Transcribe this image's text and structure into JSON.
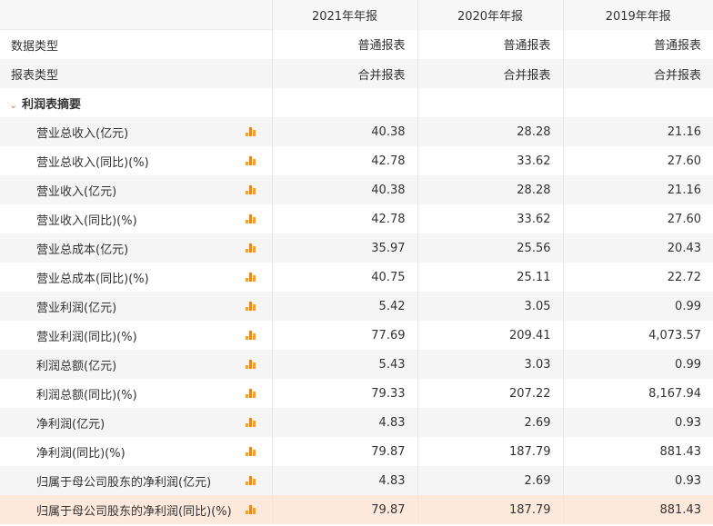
{
  "header": {
    "years": [
      "2021年年报",
      "2020年年报",
      "2019年年报"
    ]
  },
  "meta_rows": [
    {
      "label": "数据类型",
      "values": [
        "普通报表",
        "普通报表",
        "普通报表"
      ]
    },
    {
      "label": "报表类型",
      "values": [
        "合并报表",
        "合并报表",
        "合并报表"
      ]
    }
  ],
  "section": {
    "toggle_icon": "chevron-down-icon",
    "title": "利润表摘要"
  },
  "rows": [
    {
      "label": "营业总收入(亿元)",
      "values": [
        "40.38",
        "28.28",
        "21.16"
      ]
    },
    {
      "label": "营业总收入(同比)(%)",
      "values": [
        "42.78",
        "33.62",
        "27.60"
      ]
    },
    {
      "label": "营业收入(亿元)",
      "values": [
        "40.38",
        "28.28",
        "21.16"
      ]
    },
    {
      "label": "营业收入(同比)(%)",
      "values": [
        "42.78",
        "33.62",
        "27.60"
      ]
    },
    {
      "label": "营业总成本(亿元)",
      "values": [
        "35.97",
        "25.56",
        "20.43"
      ]
    },
    {
      "label": "营业总成本(同比)(%)",
      "values": [
        "40.75",
        "25.11",
        "22.72"
      ]
    },
    {
      "label": "营业利润(亿元)",
      "values": [
        "5.42",
        "3.05",
        "0.99"
      ]
    },
    {
      "label": "营业利润(同比)(%)",
      "values": [
        "77.69",
        "209.41",
        "4,073.57"
      ]
    },
    {
      "label": "利润总额(亿元)",
      "values": [
        "5.43",
        "3.03",
        "0.99"
      ]
    },
    {
      "label": "利润总额(同比)(%)",
      "values": [
        "79.33",
        "207.22",
        "8,167.94"
      ]
    },
    {
      "label": "净利润(亿元)",
      "values": [
        "4.83",
        "2.69",
        "0.93"
      ]
    },
    {
      "label": "净利润(同比)(%)",
      "values": [
        "79.87",
        "187.79",
        "881.43"
      ]
    },
    {
      "label": "归属于母公司股东的净利润(亿元)",
      "values": [
        "4.83",
        "2.69",
        "0.93"
      ]
    },
    {
      "label": "归属于母公司股东的净利润(同比)(%)",
      "values": [
        "79.87",
        "187.79",
        "881.43"
      ]
    }
  ],
  "highlighted_row": 13,
  "row_icon": "bar-chart-icon",
  "colors": {
    "header_bg": "#f7f7f7",
    "stripe_bg": "#f5f5f5",
    "highlight_bg": "#fde9dc",
    "icon_accent": "#f0a030"
  }
}
